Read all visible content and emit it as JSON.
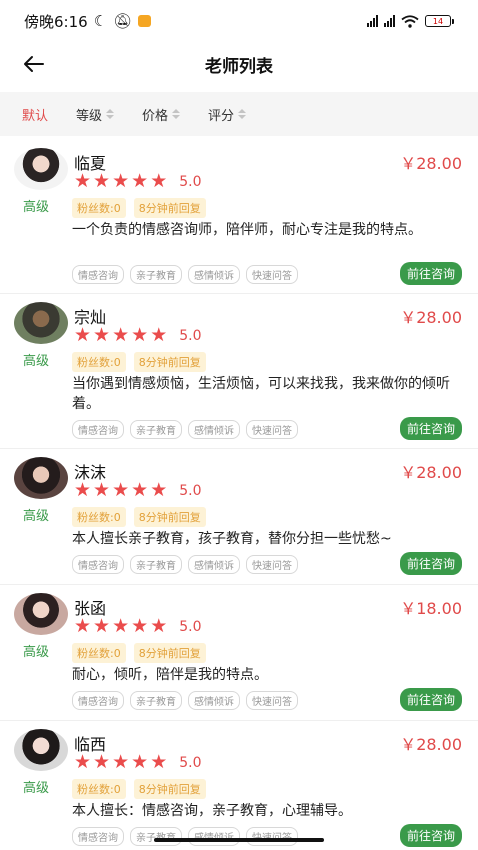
{
  "status_bar": {
    "time": "傍晚6:16",
    "battery": "14"
  },
  "nav": {
    "title": "老师列表"
  },
  "sort": [
    {
      "label": "默认",
      "active": true
    },
    {
      "label": "等级",
      "active": false
    },
    {
      "label": "价格",
      "active": false
    },
    {
      "label": "评分",
      "active": false
    }
  ],
  "teachers": [
    {
      "name": "临夏",
      "price": "￥28.00",
      "score": "5.0",
      "level": "高级",
      "fans": "粉丝数:0",
      "reply": "8分钟前回复",
      "desc": "一个负责的情感咨询师，陪伴师，耐心专注是我的特点。",
      "tags": [
        "情感咨询",
        "亲子教育",
        "感情倾诉",
        "快速问答"
      ],
      "button": "前往咨询"
    },
    {
      "name": "宗灿",
      "price": "￥28.00",
      "score": "5.0",
      "level": "高级",
      "fans": "粉丝数:0",
      "reply": "8分钟前回复",
      "desc": "当你遇到情感烦恼，生活烦恼，可以来找我，我来做你的倾听着。",
      "tags": [
        "情感咨询",
        "亲子教育",
        "感情倾诉",
        "快速问答"
      ],
      "button": "前往咨询"
    },
    {
      "name": "沫沫",
      "price": "￥28.00",
      "score": "5.0",
      "level": "高级",
      "fans": "粉丝数:0",
      "reply": "8分钟前回复",
      "desc": "本人擅长亲子教育，孩子教育，替你分担一些忧愁~",
      "tags": [
        "情感咨询",
        "亲子教育",
        "感情倾诉",
        "快速问答"
      ],
      "button": "前往咨询"
    },
    {
      "name": "张函",
      "price": "￥18.00",
      "score": "5.0",
      "level": "高级",
      "fans": "粉丝数:0",
      "reply": "8分钟前回复",
      "desc": "耐心，倾听，陪伴是我的特点。",
      "tags": [
        "情感咨询",
        "亲子教育",
        "感情倾诉",
        "快速问答"
      ],
      "button": "前往咨询"
    },
    {
      "name": "临西",
      "price": "￥28.00",
      "score": "5.0",
      "level": "高级",
      "fans": "粉丝数:0",
      "reply": "8分钟前回复",
      "desc": "本人擅长：情感咨询，亲子教育，心理辅导。",
      "tags": [
        "情感咨询",
        "亲子教育",
        "感情倾诉",
        "快速问答"
      ],
      "button": "前往咨询"
    }
  ]
}
